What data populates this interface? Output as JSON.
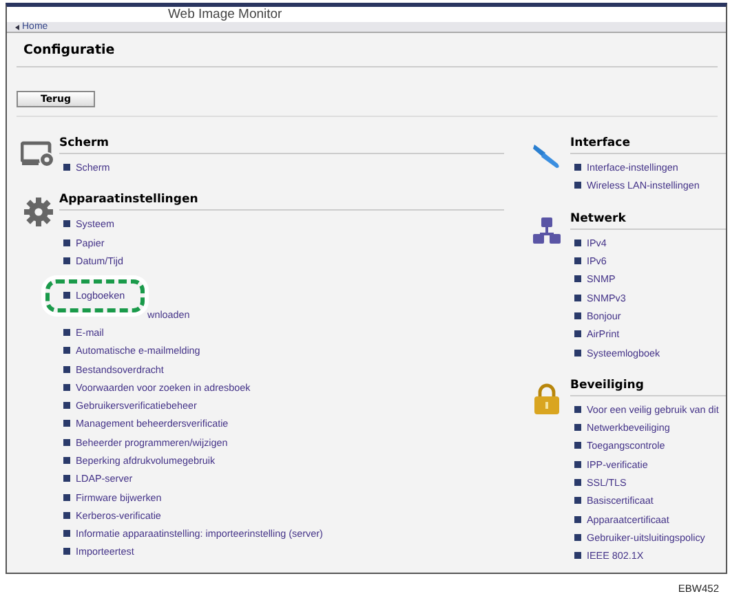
{
  "window": {
    "title": "Web Image Monitor"
  },
  "breadcrumb": "Home",
  "page_title": "Configuratie",
  "back_button": "Terug",
  "left_sections": [
    {
      "kind": "display",
      "title": "Scherm",
      "items": [
        {
          "label": "Scherm",
          "kind": "link",
          "highlighted": false
        }
      ]
    },
    {
      "kind": "gear",
      "title": "Apparaatinstellingen",
      "items": [
        {
          "label": "Systeem",
          "kind": "link",
          "highlighted": false
        },
        {
          "label": "Papier",
          "kind": "link",
          "highlighted": false
        },
        {
          "label": "Datum/Tijd",
          "kind": "link",
          "highlighted": false
        },
        {
          "label": "Logboeken",
          "kind": "link",
          "highlighted": true
        },
        {
          "label": "wnloaden",
          "kind": "partial",
          "highlighted": false
        },
        {
          "label": "E-mail",
          "kind": "link",
          "highlighted": false
        },
        {
          "label": "Automatische e-mailmelding",
          "kind": "link",
          "highlighted": false
        },
        {
          "label": "Bestandsoverdracht",
          "kind": "link",
          "highlighted": false
        },
        {
          "label": "Voorwaarden voor zoeken in adresboek",
          "kind": "link",
          "highlighted": false
        },
        {
          "label": "Gebruikersverificatiebeheer",
          "kind": "link",
          "highlighted": false
        },
        {
          "label": "Management beheerdersverificatie",
          "kind": "link",
          "highlighted": false
        },
        {
          "label": "Beheerder programmeren/wijzigen",
          "kind": "link",
          "highlighted": false
        },
        {
          "label": "Beperking afdrukvolumegebruik",
          "kind": "link",
          "highlighted": false
        },
        {
          "label": "LDAP-server",
          "kind": "link",
          "highlighted": false
        },
        {
          "label": "Firmware bijwerken",
          "kind": "link",
          "highlighted": false
        },
        {
          "label": "Kerberos-verificatie",
          "kind": "link",
          "highlighted": false
        },
        {
          "label": "Informatie apparaatinstelling: importeerinstelling (server)",
          "kind": "link",
          "highlighted": false
        },
        {
          "label": "Importeertest",
          "kind": "link",
          "highlighted": false
        }
      ]
    }
  ],
  "right_sections": [
    {
      "kind": "cable",
      "title": "Interface",
      "items": [
        {
          "label": "Interface-instellingen",
          "kind": "link",
          "highlighted": false
        },
        {
          "label": "Wireless LAN-instellingen",
          "kind": "link",
          "highlighted": false
        }
      ]
    },
    {
      "kind": "network",
      "title": "Netwerk",
      "items": [
        {
          "label": "IPv4",
          "kind": "link",
          "highlighted": false
        },
        {
          "label": "IPv6",
          "kind": "link",
          "highlighted": false
        },
        {
          "label": "SNMP",
          "kind": "link",
          "highlighted": false
        },
        {
          "label": "SNMPv3",
          "kind": "link",
          "highlighted": false
        },
        {
          "label": "Bonjour",
          "kind": "link",
          "highlighted": false
        },
        {
          "label": "AirPrint",
          "kind": "link",
          "highlighted": false
        },
        {
          "label": "Systeemlogboek",
          "kind": "link",
          "highlighted": false
        }
      ]
    },
    {
      "kind": "lock",
      "title": "Beveiliging",
      "items": [
        {
          "label": "Voor een veilig gebruik van dit",
          "kind": "link",
          "highlighted": false
        },
        {
          "label": "Netwerkbeveiliging",
          "kind": "link",
          "highlighted": false
        },
        {
          "label": "Toegangscontrole",
          "kind": "link",
          "highlighted": false
        },
        {
          "label": "IPP-verificatie",
          "kind": "link",
          "highlighted": false
        },
        {
          "label": "SSL/TLS",
          "kind": "link",
          "highlighted": false
        },
        {
          "label": "Basiscertificaat",
          "kind": "link",
          "highlighted": false
        },
        {
          "label": "Apparaatcertificaat",
          "kind": "link",
          "highlighted": false
        },
        {
          "label": "Gebruiker-uitsluitingspolicy",
          "kind": "link",
          "highlighted": false
        },
        {
          "label": "IEEE 802.1X",
          "kind": "link",
          "highlighted": false
        }
      ]
    }
  ],
  "figure_code": "EBW452"
}
